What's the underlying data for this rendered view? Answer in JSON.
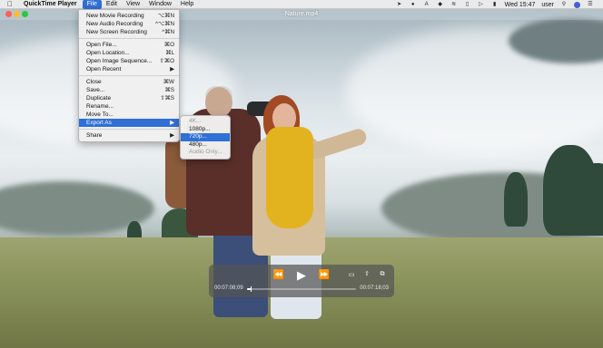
{
  "menubar": {
    "app_name": "QuickTime Player",
    "menus": [
      "File",
      "Edit",
      "View",
      "Window",
      "Help"
    ],
    "clock": "Wed 15:47",
    "user": "user"
  },
  "window": {
    "title": "Nature.mp4"
  },
  "file_menu": {
    "items": [
      {
        "label": "New Movie Recording",
        "shortcut": "⌥⌘N"
      },
      {
        "label": "New Audio Recording",
        "shortcut": "^⌥⌘N"
      },
      {
        "label": "New Screen Recording",
        "shortcut": "^⌘N"
      },
      {
        "label": "Open File...",
        "shortcut": "⌘O"
      },
      {
        "label": "Open Location...",
        "shortcut": "⌘L"
      },
      {
        "label": "Open Image Sequence...",
        "shortcut": "⇧⌘O"
      },
      {
        "label": "Open Recent",
        "shortcut": "▶"
      },
      {
        "label": "Close",
        "shortcut": "⌘W"
      },
      {
        "label": "Save...",
        "shortcut": "⌘S"
      },
      {
        "label": "Duplicate",
        "shortcut": "⇧⌘S"
      },
      {
        "label": "Rename...",
        "shortcut": ""
      },
      {
        "label": "Move To...",
        "shortcut": ""
      },
      {
        "label": "Export As",
        "shortcut": "▶"
      },
      {
        "label": "Share",
        "shortcut": "▶"
      }
    ]
  },
  "export_submenu": {
    "items": [
      "4K...",
      "1080p...",
      "720p...",
      "480p...",
      "Audio Only..."
    ],
    "highlighted": "720p..."
  },
  "player": {
    "current_time": "00:07:08;09",
    "remaining_time": "00:07:18;03",
    "progress": 0.03
  }
}
